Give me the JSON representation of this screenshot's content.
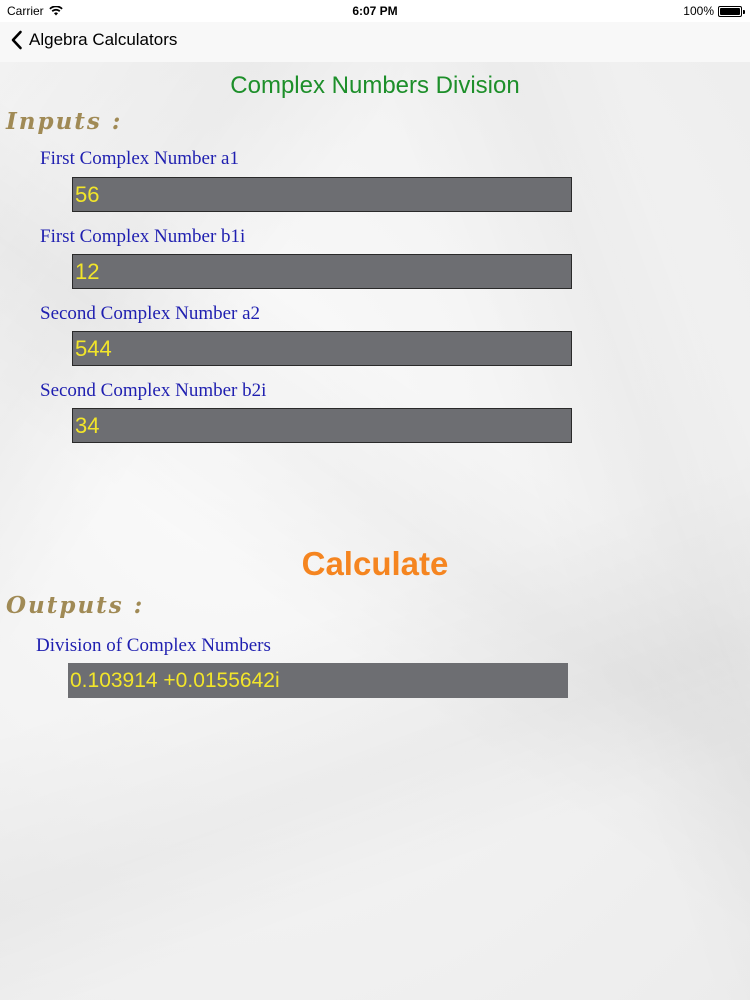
{
  "status_bar": {
    "carrier": "Carrier",
    "time": "6:07 PM",
    "battery": "100%"
  },
  "nav": {
    "back_label": "Algebra Calculators"
  },
  "title": "Complex Numbers Division",
  "inputs": {
    "heading": "Inputs :",
    "fields": [
      {
        "label": "First Complex Number a1",
        "value": "56"
      },
      {
        "label": "First Complex Number b1i",
        "value": "12"
      },
      {
        "label": "Second Complex Number a2",
        "value": "544"
      },
      {
        "label": "Second Complex Number b2i",
        "value": "34"
      }
    ]
  },
  "calculate_label": "Calculate",
  "outputs": {
    "heading": "Outputs :",
    "label": "Division of Complex Numbers",
    "value": "0.103914 +0.0155642i"
  },
  "colors": {
    "title": "#1d8f2a",
    "heading": "#a08a55",
    "label": "#1f1fb0",
    "field_bg": "#6d6e72",
    "field_text": "#f2e52a",
    "calculate": "#f58520"
  }
}
